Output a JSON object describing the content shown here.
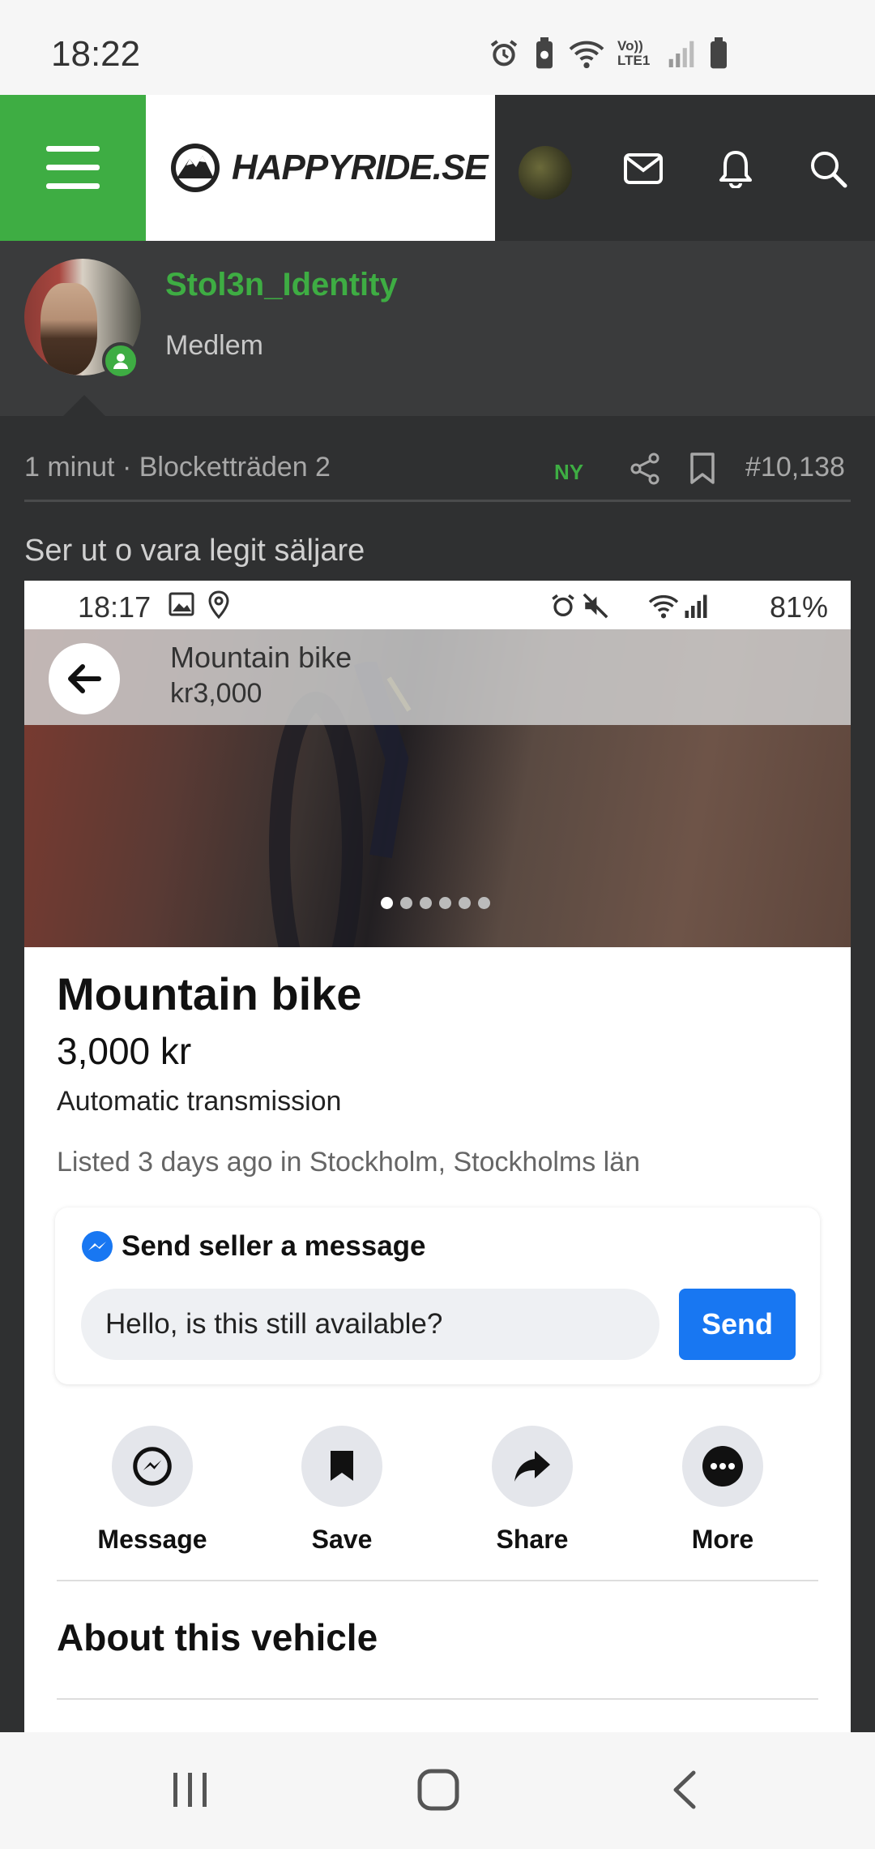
{
  "status_bar": {
    "time": "18:22",
    "icons": [
      "alarm-icon",
      "battery-saver-icon",
      "wifi-icon",
      "volte-icon",
      "signal-icon",
      "battery-icon"
    ],
    "volte_label": "Vo)) LTE1"
  },
  "header": {
    "logo_text": "HAPPYRIDE.SE",
    "icons": [
      "menu-icon",
      "avatar",
      "mail-icon",
      "bell-icon",
      "search-icon"
    ]
  },
  "user": {
    "name": "Stol3n_Identity",
    "title": "Medlem"
  },
  "post": {
    "meta": "1 minut · Blocketträden 2",
    "new_badge": "NY",
    "number": "#10,138",
    "text": "Ser ut o vara legit säljare"
  },
  "embed": {
    "status_time": "18:17",
    "status_battery": "81%",
    "photo_bar": {
      "title": "Mountain bike",
      "price": "kr3,000"
    },
    "photo_count": 6,
    "active_photo": 1,
    "listing": {
      "title": "Mountain bike",
      "price": "3,000 kr",
      "subtitle": "Automatic transmission",
      "listed": "Listed 3 days ago in Stockholm, Stockholms län"
    },
    "message_card": {
      "heading": "Send seller a message",
      "input_value": "Hello, is this still available?",
      "send_label": "Send"
    },
    "actions": [
      {
        "label": "Message",
        "icon": "messenger-icon"
      },
      {
        "label": "Save",
        "icon": "bookmark-icon"
      },
      {
        "label": "Share",
        "icon": "share-arrow-icon"
      },
      {
        "label": "More",
        "icon": "more-icon"
      }
    ],
    "about_title": "About this vehicle"
  },
  "colors": {
    "accent_green": "#3ead43",
    "facebook_blue": "#1877f2",
    "forum_bg": "#2f3031"
  }
}
